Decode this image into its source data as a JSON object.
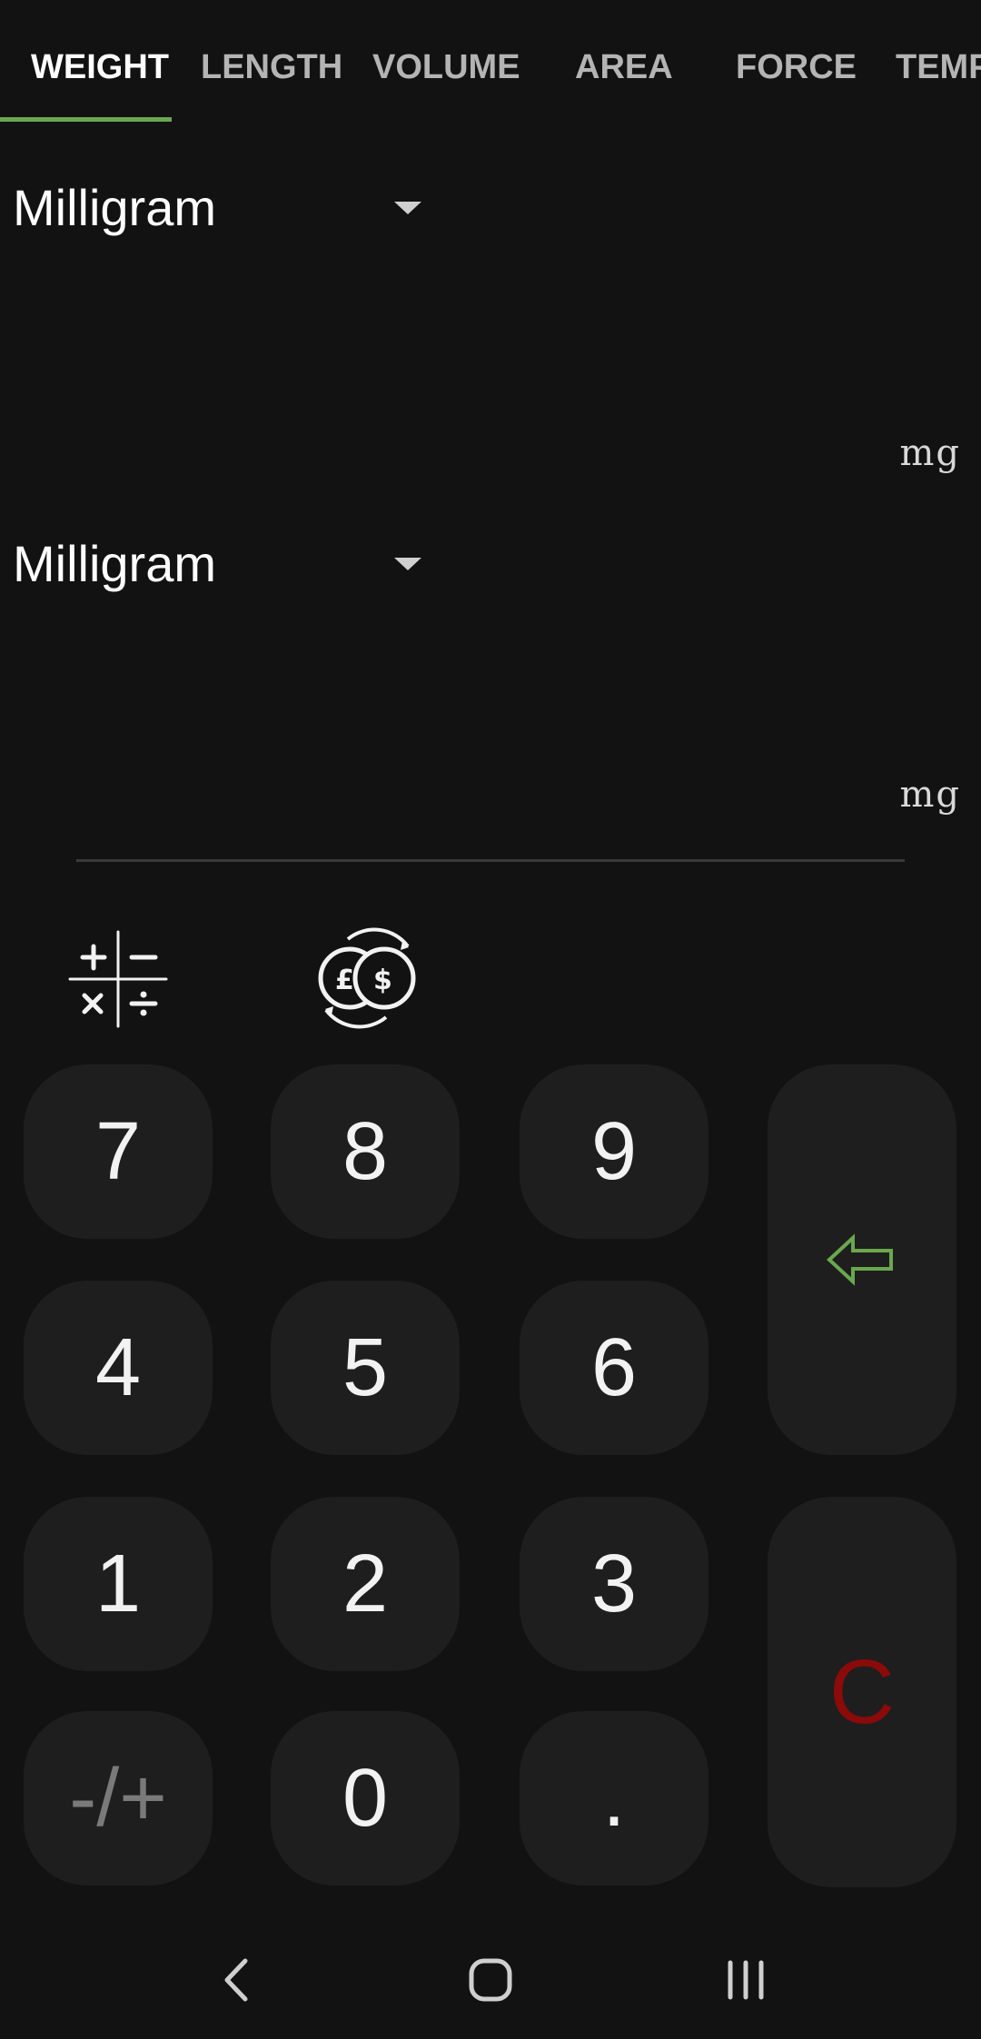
{
  "tabs": [
    {
      "label": "WEIGHT",
      "active": true
    },
    {
      "label": "LENGTH",
      "active": false
    },
    {
      "label": "VOLUME",
      "active": false
    },
    {
      "label": "AREA",
      "active": false
    },
    {
      "label": "FORCE",
      "active": false
    },
    {
      "label": "TEMP",
      "active": false
    }
  ],
  "from": {
    "unit": "Milligram",
    "value": "",
    "suffix": "mg"
  },
  "to": {
    "unit": "Milligram",
    "value": "",
    "suffix": "mg"
  },
  "modes": {
    "calculator_icon": "calculator-icon",
    "currency_icon": "currency-exchange-icon"
  },
  "keypad": {
    "k7": "7",
    "k8": "8",
    "k9": "9",
    "k4": "4",
    "k5": "5",
    "k6": "6",
    "k1": "1",
    "k2": "2",
    "k3": "3",
    "sign": "-/+",
    "k0": "0",
    "dot": ".",
    "backspace_icon": "backspace-arrow-icon",
    "clear": "C"
  },
  "colors": {
    "accent": "#6aa84f",
    "clear": "#8b0a0a",
    "background": "#121212",
    "key": "#1e1e1e"
  }
}
